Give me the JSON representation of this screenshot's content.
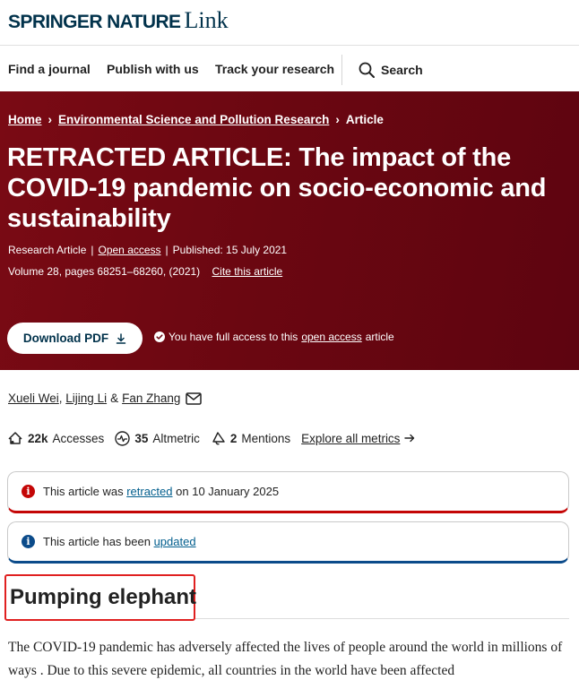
{
  "brand": {
    "name": "SPRINGER NATURE",
    "suffix": "Link"
  },
  "nav": {
    "items": [
      "Find a journal",
      "Publish with us",
      "Track your research"
    ],
    "search_label": "Search"
  },
  "breadcrumb": {
    "home": "Home",
    "journal": "Environmental Science and Pollution Research",
    "current": "Article"
  },
  "article": {
    "title": "RETRACTED ARTICLE: The impact of the COVID-19 pandemic on socio-economic and sustainability",
    "type": "Research Article",
    "access_type": "Open access",
    "published": "Published: 15 July 2021",
    "volume": "Volume 28, pages 68251–68260, (2021)",
    "cite": "Cite this article"
  },
  "download": {
    "label": "Download PDF"
  },
  "access_note": {
    "prefix": "You have full access to this",
    "link": "open access",
    "suffix": "article"
  },
  "authors": {
    "a1": "Xueli Wei",
    "a2": "Lijing Li",
    "amp": "&",
    "a3": "Fan Zhang"
  },
  "metrics": {
    "accesses_value": "22k",
    "accesses_label": "Accesses",
    "altmetric_value": "35",
    "altmetric_label": "Altmetric",
    "mentions_value": "2",
    "mentions_label": "Mentions",
    "explore_label": "Explore all metrics"
  },
  "notices": {
    "retracted": {
      "prefix": "This article was",
      "link": "retracted",
      "suffix": "on 10 January 2025"
    },
    "updated": {
      "prefix": "This article has been",
      "link": "updated"
    }
  },
  "section": {
    "heading": "Pumping elephant"
  },
  "body": {
    "text": "The COVID-19 pandemic has adversely affected the lives of people around the world in millions of ways . Due to this severe epidemic, all countries in the world have been affected"
  },
  "colors": {
    "hero": "#6b0711",
    "brand": "#01324b",
    "retracted": "#c40606",
    "updated": "#0b4b8a",
    "highlight": "#e02020"
  }
}
